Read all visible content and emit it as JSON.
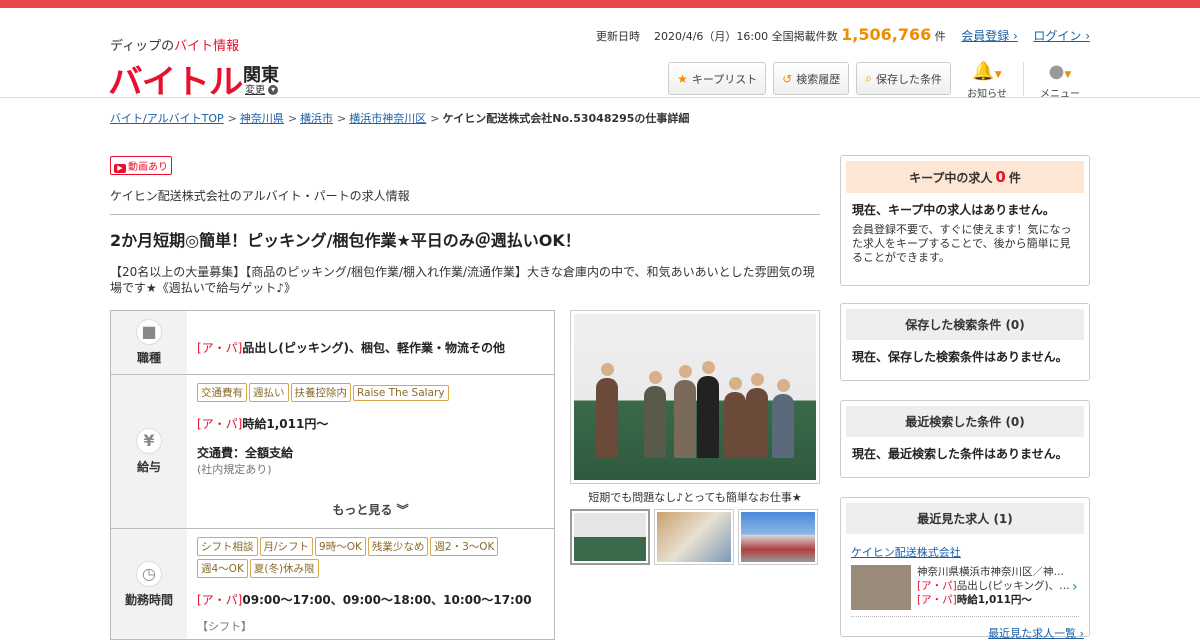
{
  "header": {
    "logo_sub_prefix": "ディップの",
    "logo_sub_red": "バイト情報",
    "logo_main": "バイトル",
    "region": "関東",
    "region_change": "変更",
    "updated_label": "更新日時",
    "updated_value": "2020/4/6（月）16:00",
    "total_label": "全国掲載件数",
    "total_count": "1,506,766",
    "total_unit": "件",
    "register_link": "会員登録",
    "login_link": "ログイン",
    "buttons": {
      "keep_list": "キープリスト",
      "search_history": "検索履歴",
      "saved_conditions": "保存した条件"
    },
    "notifications_label": "お知らせ",
    "menu_label": "メニュー"
  },
  "breadcrumb": {
    "items": [
      "バイト/アルバイトTOP",
      "神奈川県",
      "横浜市",
      "横浜市神奈川区"
    ],
    "current": "ケイヒン配送株式会社No.53048295の仕事詳細"
  },
  "job": {
    "badge": "動画あり",
    "company_line": "ケイヒン配送株式会社のアルバイト・パートの求人情報",
    "title": "2か月短期◎簡単！ピッキング/梱包作業★平日のみ＠週払いOK！",
    "description": "【20名以上の大量募集】【商品のピッキング/梱包作業/棚入れ作業/流通作業】大きな倉庫内の中で、和気あいあいとした雰囲気の現場です★《週払いで給与ゲット♪》",
    "ap_label": "[ア・パ]",
    "occupation": {
      "label": "職種",
      "value": "品出し(ピッキング)、梱包、軽作業・物流その他"
    },
    "salary": {
      "label": "給与",
      "tags": [
        "交通費有",
        "週払い",
        "扶養控除内",
        "Raise The Salary"
      ],
      "wage": "時給1,011円～",
      "transport": "交通費：全額支給",
      "transport_note": "(社内規定あり)",
      "more": "もっと見る"
    },
    "hours": {
      "label": "勤務時間",
      "tags": [
        "シフト相談",
        "月/シフト",
        "9時～OK",
        "残業少なめ",
        "週2・3〜OK",
        "週4〜OK",
        "夏(冬)休み限"
      ],
      "value": "09:00～17:00、09:00～18:00、10:00～17:00",
      "note": "【シフト】"
    },
    "photo_caption": "短期でも問題なし♪とっても簡単なお仕事★"
  },
  "sidebar": {
    "keep": {
      "title": "キープ中の求人",
      "count": "0",
      "unit": "件",
      "empty": "現在、キープ中の求人はありません。",
      "note": "会員登録不要で、すぐに使えます！気になった求人をキープすることで、後から簡単に見ることができます。"
    },
    "saved": {
      "title": "保存した検索条件",
      "count": "(0)",
      "empty": "現在、保存した検索条件はありません。"
    },
    "recent_search": {
      "title": "最近検索した条件",
      "count": "(0)",
      "empty": "現在、最近検索した条件はありません。"
    },
    "recent_jobs": {
      "title": "最近見た求人",
      "count": "(1)",
      "company": "ケイヒン配送株式会社",
      "location": "神奈川県横浜市神奈川区／神…",
      "job": "品出し(ピッキング)、…",
      "wage": "時給1,011円～",
      "more": "最近見た求人一覧"
    }
  },
  "colors": {
    "brand_red": "#e8112d",
    "accent_orange": "#f08c00",
    "link_blue": "#1a5fa8"
  }
}
